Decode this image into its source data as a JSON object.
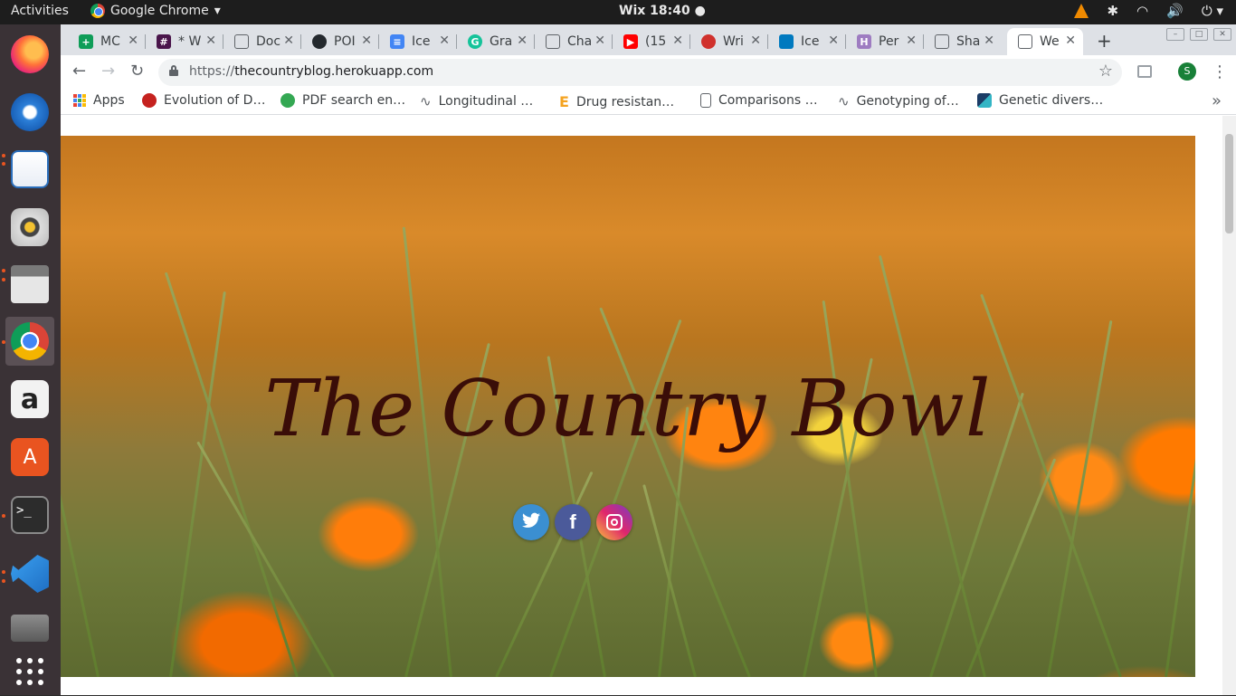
{
  "topbar": {
    "activities": "Activities",
    "app_name": "Google Chrome",
    "clock": "Wix 18:40 ●",
    "tray_icons": [
      "vlc-icon",
      "bluetooth-icon",
      "wifi-icon",
      "volume-icon",
      "power-icon"
    ]
  },
  "dock": {
    "items": [
      "firefox",
      "thunderbird",
      "libreoffice-writer",
      "rhythmbox",
      "files",
      "chrome",
      "amazon",
      "ubuntu-software",
      "terminal",
      "vscode",
      "photos",
      "show-apps"
    ]
  },
  "tabs": [
    {
      "title": "MC",
      "icon": "sheets-icon",
      "color": "#0f9d58"
    },
    {
      "title": "* W",
      "icon": "slack-icon",
      "color": "#4a154b"
    },
    {
      "title": "Doc",
      "icon": "doc-icon",
      "color": "#ffffff"
    },
    {
      "title": "POI",
      "icon": "github-icon",
      "color": "#24292e"
    },
    {
      "title": "Ice",
      "icon": "gdocs-icon",
      "color": "#4285f4"
    },
    {
      "title": "Gra",
      "icon": "grammarly-icon",
      "color": "#15c39a"
    },
    {
      "title": "Cha",
      "icon": "doc-icon",
      "color": "#ffffff"
    },
    {
      "title": "(15",
      "icon": "youtube-icon",
      "color": "#ff0000"
    },
    {
      "title": "Wri",
      "icon": "wri-icon",
      "color": "#d0312d"
    },
    {
      "title": "Ice",
      "icon": "trello-icon",
      "color": "#0079bf"
    },
    {
      "title": "Per",
      "icon": "heroku-icon",
      "color": "#9e7cc1"
    },
    {
      "title": "Sha",
      "icon": "doc-icon",
      "color": "#ffffff"
    },
    {
      "title": "We",
      "icon": "doc-icon",
      "color": "#ffffff",
      "active": true
    }
  ],
  "toolbar": {
    "url_proto": "https://",
    "url_host": "thecountryblog.herokuapp.com",
    "avatar_letter": "S"
  },
  "bookmarks": [
    {
      "label": "Apps",
      "icon": "apps-grid-icon"
    },
    {
      "label": "Evolution of D…",
      "icon": "red-circle-icon",
      "color": "#c5221f"
    },
    {
      "label": "PDF search en…",
      "icon": "green-circle-icon",
      "color": "#34a853"
    },
    {
      "label": "Longitudinal …",
      "icon": "link-icon"
    },
    {
      "label": "Drug resistan…",
      "icon": "e-icon",
      "color": "#f4a321"
    },
    {
      "label": "Comparisons …",
      "icon": "doc-icon"
    },
    {
      "label": "Genotyping of…",
      "icon": "link-icon"
    },
    {
      "label": "Genetic divers…",
      "icon": "triangle-icon",
      "color": "#1b3c66"
    }
  ],
  "page": {
    "title": "The Country Bowl",
    "title_color": "#3a0d08",
    "social": {
      "twitter": "twitter-icon",
      "facebook": "f",
      "instagram": "instagram-icon"
    }
  }
}
